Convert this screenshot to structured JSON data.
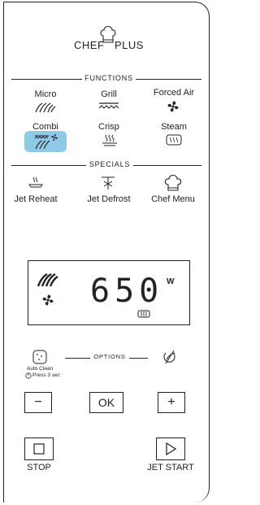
{
  "brand": {
    "left": "CHEF",
    "right": "PLUS"
  },
  "sections": {
    "functions": "FUNCTIONS",
    "specials": "SPECIALS",
    "options": "OPTIONS"
  },
  "functions": [
    {
      "label": "Micro",
      "icon": "microwave-waves-icon"
    },
    {
      "label": "Grill",
      "icon": "grill-icon"
    },
    {
      "label": "Forced Air",
      "icon": "fan-icon"
    },
    {
      "label": "Combi",
      "icon": "combi-icon",
      "active": true
    },
    {
      "label": "Crisp",
      "icon": "crisp-icon"
    },
    {
      "label": "Steam",
      "icon": "steam-icon"
    }
  ],
  "specials": [
    {
      "label": "Jet Reheat",
      "icon": "plate-icon"
    },
    {
      "label": "Jet Defrost",
      "icon": "snowflake-icon"
    },
    {
      "label": "Chef Menu",
      "icon": "chef-hat-icon"
    }
  ],
  "display": {
    "value": "650",
    "unit": "W"
  },
  "options": {
    "auto_clean_label": "Auto Clean",
    "press_hint": "Press 3 sec"
  },
  "controls": {
    "minus": "−",
    "ok": "OK",
    "plus": "+",
    "stop": "STOP",
    "start": "JET START"
  },
  "colors": {
    "active_highlight": "#8ec9e6"
  }
}
